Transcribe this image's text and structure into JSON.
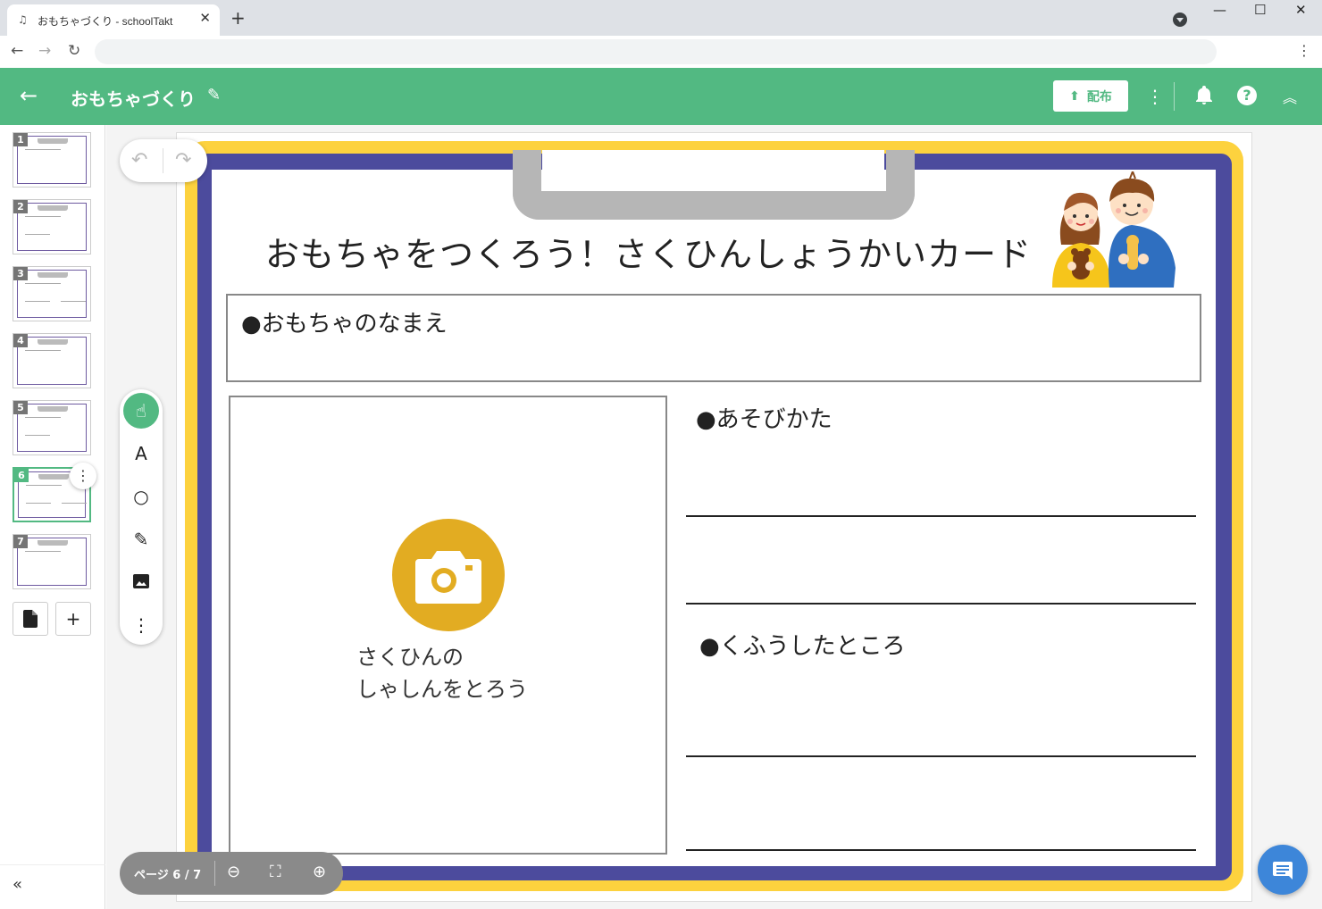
{
  "browser": {
    "tab_title": "おもちゃづくり - schoolTakt",
    "tab_close": "✕",
    "new_tab": "+",
    "window_controls": [
      "—",
      "☐",
      "✕"
    ],
    "nav": [
      "←",
      "→",
      "↻"
    ],
    "address": "",
    "menu": "⋮"
  },
  "appbar": {
    "back_icon": "←",
    "title": "おもちゃづくり",
    "edit_icon": "✎",
    "distribute_label": "配布",
    "distribute_icon": "⬆",
    "more_icon": "⋮",
    "bell_icon": "🔔",
    "help_icon": "?",
    "collapse_icon": "︽"
  },
  "sidebar": {
    "pages": [
      {
        "num": "1"
      },
      {
        "num": "2"
      },
      {
        "num": "3"
      },
      {
        "num": "4"
      },
      {
        "num": "5"
      },
      {
        "num": "6"
      },
      {
        "num": "7"
      }
    ],
    "active_page": "6",
    "thumb_menu_icon": "⋮",
    "add_doc_icon": "📄",
    "add_page_icon": "+",
    "collapse_icon": "«"
  },
  "card": {
    "title": "おもちゃをつくろう！さくひんしょうかいカード",
    "name_label": "●おもちゃのなまえ",
    "play_label": "●あそびかた",
    "idea_label": "●くふうしたところ",
    "photo_line1": "さくひんの",
    "photo_line2": "しゃしんをとろう"
  },
  "tools": {
    "undo_icon": "↶",
    "redo_icon": "↷",
    "pointer_icon": "☝",
    "text_icon": "A",
    "shape_icon": "○",
    "pen_icon": "✎",
    "image_icon": "▣",
    "more_icon": "⋮"
  },
  "pager": {
    "label": "ページ 6 / 7",
    "zoom_out_icon": "⊖",
    "fit_icon": "⛶",
    "zoom_in_icon": "⊕"
  },
  "chat_icon": "💬",
  "colors": {
    "accent": "#52b982",
    "frame_yellow": "#fdd23e",
    "frame_blue": "#4c4b9d",
    "camera": "#e2ac22",
    "chat_fab": "#3d86d9"
  }
}
